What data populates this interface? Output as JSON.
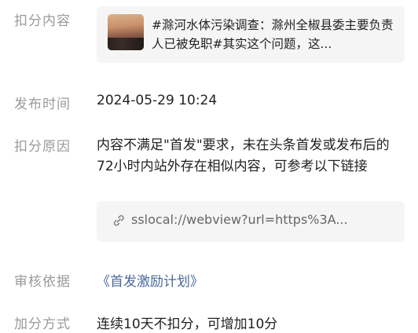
{
  "deduction_content": {
    "label": "扣分内容",
    "card_title": "#滁河水体污染调查：滁州全椒县委主要负责人已被免职#其实这个问题，这..."
  },
  "publish_time": {
    "label": "发布时间",
    "value": "2024-05-29 10:24"
  },
  "deduction_reason": {
    "label": "扣分原因",
    "value": "内容不满足\"首发\"要求，未在头条首发或发布后的72小时内站外存在相似内容，可参考以下链接",
    "link_icon": "link-icon",
    "link_text": "sslocal://webview?url=https%3A..."
  },
  "review_basis": {
    "label": "审核依据",
    "value": "《首发激励计划》"
  },
  "bonus_method": {
    "label": "加分方式",
    "value": "连续10天不扣分，可增加10分"
  }
}
